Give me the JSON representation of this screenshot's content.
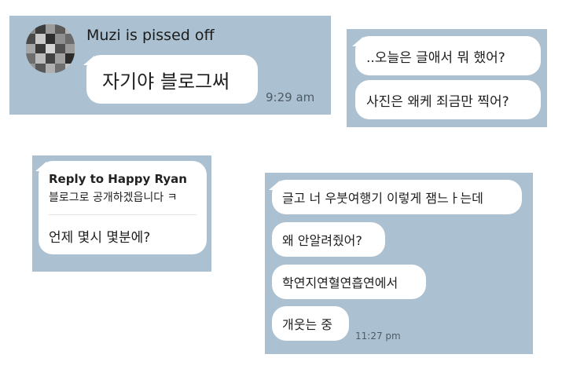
{
  "chat1": {
    "sender": "Muzi is pissed off",
    "message": "자기야 블로그써",
    "time": "9:29 am"
  },
  "chat2": {
    "messages": [
      "..오늘은 글애서 뭐 했어?",
      "사진은 왜케 죄금만 찍어?"
    ]
  },
  "chat3": {
    "reply_to": "Reply to Happy Ryan",
    "quoted": "블로그로 공개하겠읍니다 ㅋ",
    "message": "언제 몇시 몇분에?"
  },
  "chat4": {
    "messages": [
      "글고 너 우붓여행기 이렇게 잼느ㅏ는데",
      "왜 안알려줬어?",
      "학연지연혈연흡연에서",
      "개웃는 중"
    ],
    "time": "11:27 pm"
  },
  "avatar": {
    "description_icon": "pixelated-avatar-icon"
  },
  "colors": {
    "panel": "#abc1d1",
    "bubble": "#ffffff"
  }
}
